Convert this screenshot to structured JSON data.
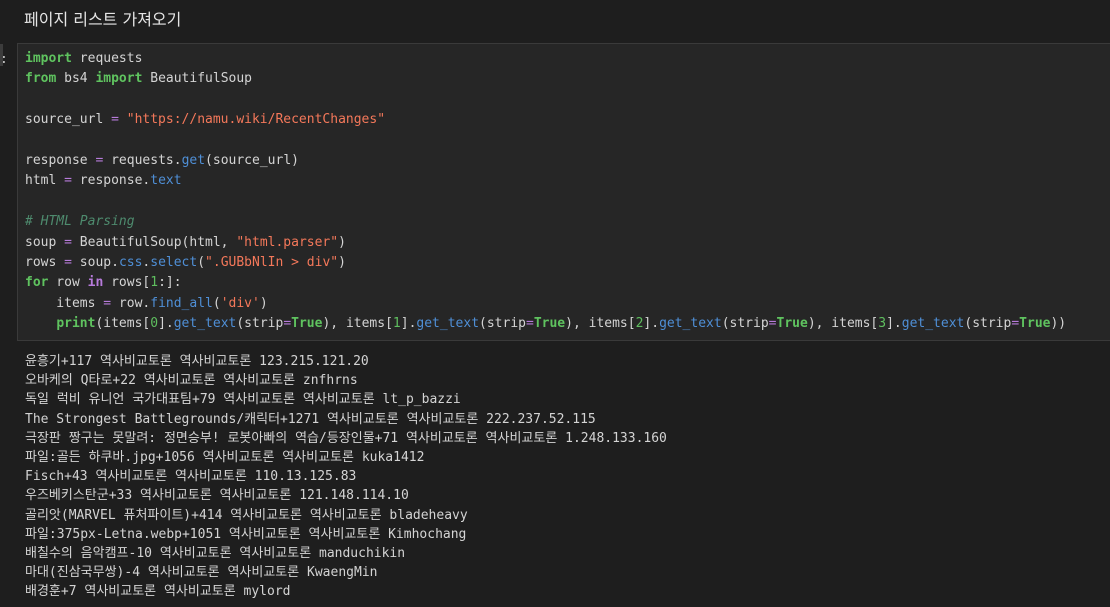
{
  "markdown_cell": {
    "heading": "페이지 리스트 가져오기"
  },
  "code_cell": {
    "prompt": ":",
    "lines": [
      [
        [
          "kw",
          "import"
        ],
        [
          "plain",
          " requests"
        ]
      ],
      [
        [
          "kw",
          "from"
        ],
        [
          "plain",
          " bs4 "
        ],
        [
          "kw",
          "import"
        ],
        [
          "plain",
          " BeautifulSoup"
        ]
      ],
      [],
      [
        [
          "plain",
          "source_url "
        ],
        [
          "op",
          "="
        ],
        [
          "plain",
          " "
        ],
        [
          "str",
          "\"https://namu.wiki/RecentChanges\""
        ]
      ],
      [],
      [
        [
          "plain",
          "response "
        ],
        [
          "op",
          "="
        ],
        [
          "plain",
          " requests."
        ],
        [
          "attr",
          "get"
        ],
        [
          "plain",
          "(source_url)"
        ]
      ],
      [
        [
          "plain",
          "html "
        ],
        [
          "op",
          "="
        ],
        [
          "plain",
          " response."
        ],
        [
          "attr",
          "text"
        ]
      ],
      [],
      [
        [
          "cm",
          "# HTML Parsing"
        ]
      ],
      [
        [
          "plain",
          "soup "
        ],
        [
          "op",
          "="
        ],
        [
          "plain",
          " BeautifulSoup(html, "
        ],
        [
          "str",
          "\"html.parser\""
        ],
        [
          "plain",
          ")"
        ]
      ],
      [
        [
          "plain",
          "rows "
        ],
        [
          "op",
          "="
        ],
        [
          "plain",
          " soup."
        ],
        [
          "attr",
          "css"
        ],
        [
          "plain",
          "."
        ],
        [
          "attr",
          "select"
        ],
        [
          "plain",
          "("
        ],
        [
          "str",
          "\".GUBbNlIn > div\""
        ],
        [
          "plain",
          ")"
        ]
      ],
      [
        [
          "kw",
          "for"
        ],
        [
          "plain",
          " row "
        ],
        [
          "kw-in",
          "in"
        ],
        [
          "plain",
          " rows["
        ],
        [
          "num",
          "1"
        ],
        [
          "plain",
          ":]:"
        ]
      ],
      [
        [
          "plain",
          "    items "
        ],
        [
          "op",
          "="
        ],
        [
          "plain",
          " row."
        ],
        [
          "attr",
          "find_all"
        ],
        [
          "plain",
          "("
        ],
        [
          "str",
          "'div'"
        ],
        [
          "plain",
          ")"
        ]
      ],
      [
        [
          "plain",
          "    "
        ],
        [
          "kw",
          "print"
        ],
        [
          "plain",
          "(items["
        ],
        [
          "num",
          "0"
        ],
        [
          "plain",
          "]."
        ],
        [
          "attr",
          "get_text"
        ],
        [
          "plain",
          "(strip"
        ],
        [
          "op",
          "="
        ],
        [
          "const",
          "True"
        ],
        [
          "plain",
          "), items["
        ],
        [
          "num",
          "1"
        ],
        [
          "plain",
          "]."
        ],
        [
          "attr",
          "get_text"
        ],
        [
          "plain",
          "(strip"
        ],
        [
          "op",
          "="
        ],
        [
          "const",
          "True"
        ],
        [
          "plain",
          "), items["
        ],
        [
          "num",
          "2"
        ],
        [
          "plain",
          "]."
        ],
        [
          "attr",
          "get_text"
        ],
        [
          "plain",
          "(strip"
        ],
        [
          "op",
          "="
        ],
        [
          "const",
          "True"
        ],
        [
          "plain",
          "), items["
        ],
        [
          "num",
          "3"
        ],
        [
          "plain",
          "]."
        ],
        [
          "attr",
          "get_text"
        ],
        [
          "plain",
          "(strip"
        ],
        [
          "op",
          "="
        ],
        [
          "const",
          "True"
        ],
        [
          "plain",
          "))"
        ]
      ]
    ]
  },
  "output": {
    "lines": [
      "윤흥기+117 역사비교토론 역사비교토론 123.215.121.20",
      "오바케의 Q타로+22 역사비교토론 역사비교토론 znfhrns",
      "독일 럭비 유니언 국가대표팀+79 역사비교토론 역사비교토론 lt_p_bazzi",
      "The Strongest Battlegrounds/캐릭터+1271 역사비교토론 역사비교토론 222.237.52.115",
      "극장판 짱구는 못말려: 정면승부! 로봇아빠의 역습/등장인물+71 역사비교토론 역사비교토론 1.248.133.160",
      "파일:골든 하쿠바.jpg+1056 역사비교토론 역사비교토론 kuka1412",
      "Fisch+43 역사비교토론 역사비교토론 110.13.125.83",
      "우즈베키스탄군+33 역사비교토론 역사비교토론 121.148.114.10",
      "골리앗(MARVEL 퓨처파이트)+414 역사비교토론 역사비교토론 bladeheavy",
      "파일:375px-Letna.webp+1051 역사비교토론 역사비교토론 Kimhochang",
      "배칠수의 음악캠프-10 역사비교토론 역사비교토론 manduchikin",
      "마대(진삼국무쌍)-4 역사비교토론 역사비교토론 KwaengMin",
      "배경훈+7 역사비교토론 역사비교토론 mylord"
    ]
  }
}
